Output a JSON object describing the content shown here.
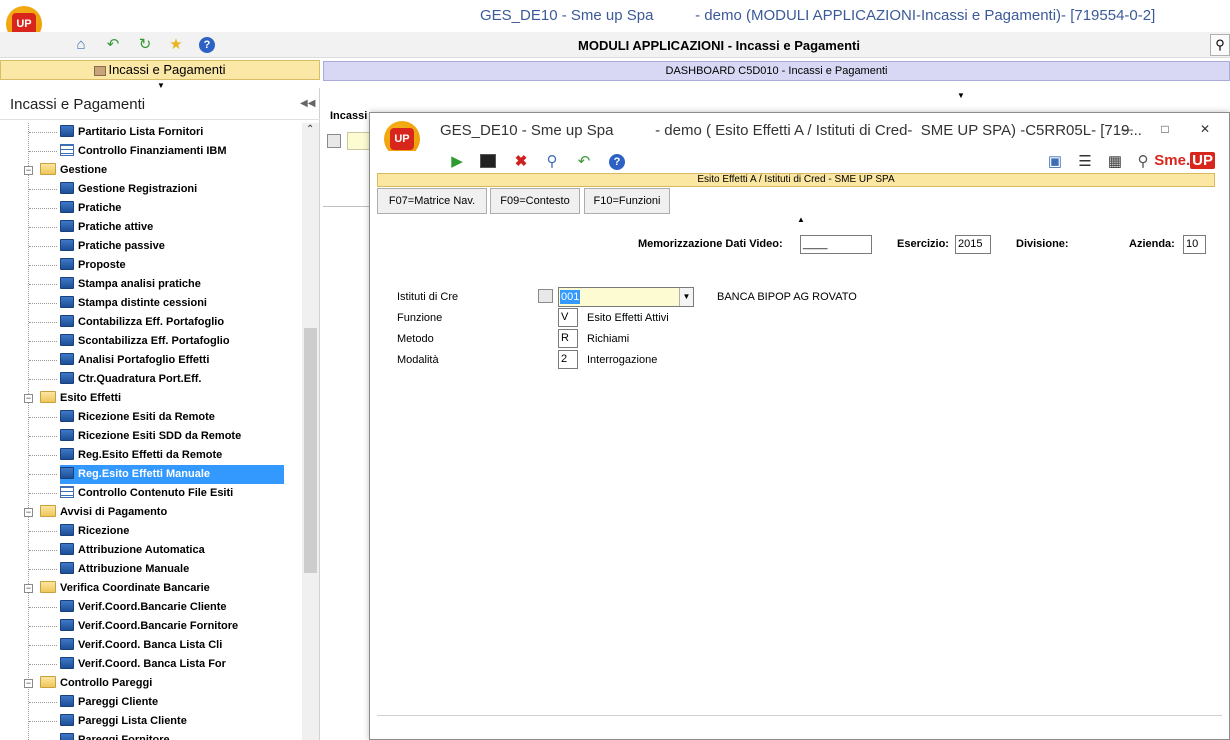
{
  "main_window": {
    "logo_text": "UP",
    "title": "GES_DE10 - Sme up Spa          - demo (MODULI APPLICAZIONI-Incassi e Pagamenti)- [719554-0-2]",
    "module_title": "MODULI APPLICAZIONI - Incassi e Pagamenti"
  },
  "tabs": {
    "left_tab_label": "Incassi e Pagamenti",
    "right_tab_label": "DASHBOARD C5D010 - Incassi e Pagamenti"
  },
  "tree": {
    "header": "Incassi e Pagamenti",
    "rows": [
      {
        "type": "item",
        "icon": "monitor",
        "label": "Partitario Lista Fornitori"
      },
      {
        "type": "item",
        "icon": "table",
        "label": "Controllo Finanziamenti IBM"
      },
      {
        "type": "group",
        "label": "Gestione"
      },
      {
        "type": "item",
        "icon": "monitor",
        "label": "Gestione Registrazioni"
      },
      {
        "type": "item",
        "icon": "monitor",
        "label": "Pratiche"
      },
      {
        "type": "item",
        "icon": "monitor",
        "label": "Pratiche attive"
      },
      {
        "type": "item",
        "icon": "monitor",
        "label": "Pratiche passive"
      },
      {
        "type": "item",
        "icon": "monitor",
        "label": "Proposte"
      },
      {
        "type": "item",
        "icon": "monitor",
        "label": "Stampa analisi pratiche"
      },
      {
        "type": "item",
        "icon": "monitor",
        "label": "Stampa distinte cessioni"
      },
      {
        "type": "item",
        "icon": "monitor",
        "label": "Contabilizza Eff. Portafoglio"
      },
      {
        "type": "item",
        "icon": "monitor",
        "label": "Scontabilizza Eff. Portafoglio"
      },
      {
        "type": "item",
        "icon": "monitor",
        "label": "Analisi Portafoglio Effetti"
      },
      {
        "type": "item",
        "icon": "monitor",
        "label": "Ctr.Quadratura Port.Eff."
      },
      {
        "type": "group",
        "label": "Esito Effetti"
      },
      {
        "type": "item",
        "icon": "monitor",
        "label": "Ricezione Esiti da Remote"
      },
      {
        "type": "item",
        "icon": "monitor",
        "label": "Ricezione Esiti SDD da Remote"
      },
      {
        "type": "item",
        "icon": "monitor",
        "label": "Reg.Esito Effetti da Remote"
      },
      {
        "type": "item",
        "icon": "monitor",
        "label": "Reg.Esito Effetti Manuale",
        "selected": true
      },
      {
        "type": "item",
        "icon": "table",
        "label": "Controllo Contenuto File Esiti"
      },
      {
        "type": "group",
        "label": "Avvisi di Pagamento"
      },
      {
        "type": "item",
        "icon": "monitor",
        "label": "Ricezione"
      },
      {
        "type": "item",
        "icon": "monitor",
        "label": "Attribuzione Automatica"
      },
      {
        "type": "item",
        "icon": "monitor",
        "label": "Attribuzione Manuale"
      },
      {
        "type": "group",
        "label": "Verifica Coordinate Bancarie"
      },
      {
        "type": "item",
        "icon": "monitor",
        "label": "Verif.Coord.Bancarie Cliente"
      },
      {
        "type": "item",
        "icon": "monitor",
        "label": "Verif.Coord.Bancarie Fornitore"
      },
      {
        "type": "item",
        "icon": "monitor",
        "label": "Verif.Coord. Banca Lista Cli"
      },
      {
        "type": "item",
        "icon": "monitor",
        "label": "Verif.Coord. Banca Lista For"
      },
      {
        "type": "group",
        "label": "Controllo Pareggi"
      },
      {
        "type": "item",
        "icon": "monitor",
        "label": "Pareggi Cliente"
      },
      {
        "type": "item",
        "icon": "monitor",
        "label": "Pareggi Lista Cliente"
      },
      {
        "type": "item",
        "icon": "monitor",
        "label": "Pareggi Fornitore"
      }
    ]
  },
  "background": {
    "label": "Incassi"
  },
  "dialog": {
    "logo_text": "UP",
    "title": "GES_DE10 - Sme up Spa          - demo ( Esito Effetti A / Istituti di Cred-  SME UP SPA) -C5RR05L- [719...",
    "band_label": "Esito Effetti A / Istituti di Cred -  SME UP SPA",
    "brand_prefix": "Sme.",
    "brand_suffix": "UP",
    "function_buttons": [
      "F07=Matrice Nav.",
      "F09=Contesto",
      "F10=Funzioni"
    ],
    "header_fields": {
      "memo_label": "Memorizzazione Dati Video:",
      "memo_value": "____",
      "esercizio_label": "Esercizio:",
      "esercizio_value": "2015",
      "divisione_label": "Divisione:",
      "azienda_label": "Azienda:",
      "azienda_value": "10"
    },
    "form": {
      "istituti_label": "Istituti di Cre",
      "istituti_value": "001",
      "istituti_desc": "BANCA BIPOP AG ROVATO",
      "funzione_label": "Funzione",
      "funzione_value": "V",
      "funzione_desc": "Esito Effetti Attivi",
      "metodo_label": "Metodo",
      "metodo_value": "R",
      "metodo_desc": "Richiami",
      "modalita_label": "Modalità",
      "modalita_value": "2",
      "modalita_desc": "Interrogazione"
    }
  },
  "colors": {
    "title_blue": "#3c5a99",
    "tab_yellow": "#fbe7a6",
    "tab_lavender": "#d8d8f4",
    "selection_blue": "#3399ff",
    "brand_red": "#d9261c"
  }
}
